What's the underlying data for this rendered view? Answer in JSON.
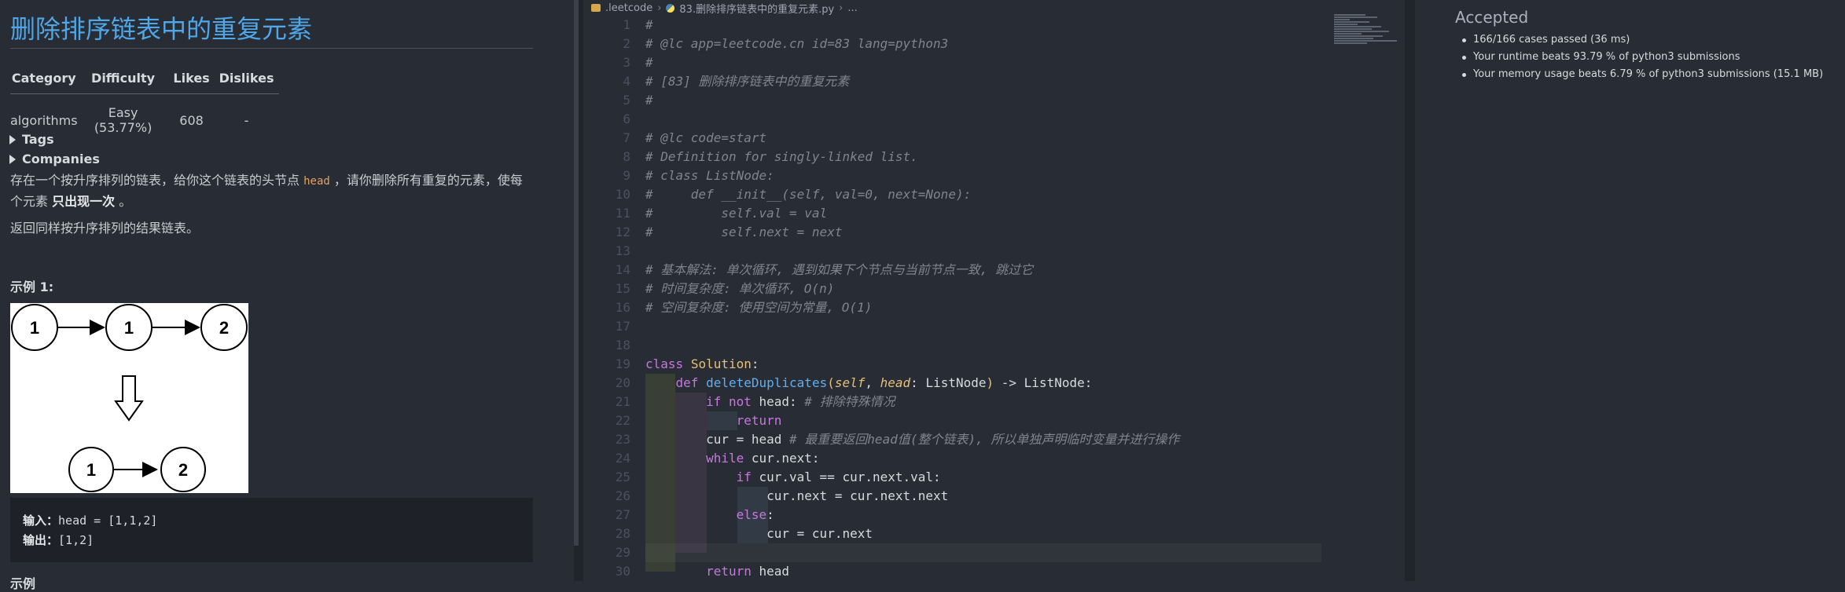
{
  "problem": {
    "title": "删除排序链表中的重复元素",
    "table": {
      "headers": [
        "Category",
        "Difficulty",
        "Likes",
        "Dislikes"
      ],
      "values": [
        "algorithms",
        "Easy (53.77%)",
        "608",
        "-"
      ]
    },
    "tags_label": "Tags",
    "companies_label": "Companies",
    "desc_part1": "存在一个按升序排列的链表，给你这个链表的头节点 ",
    "desc_code": "head",
    "desc_part2": " ，请你删除所有重复的元素，使每",
    "desc_part3": "个元素 ",
    "desc_bold": "只出现一次",
    "desc_part4": " 。",
    "desc_line2": "返回同样按升序排列的结果链表。",
    "example_label": "示例 1:",
    "diagram": {
      "top_nodes": [
        "1",
        "1",
        "2"
      ],
      "bottom_nodes": [
        "1",
        "2"
      ]
    },
    "input_label": "输入：",
    "input_value": "head = [1,1,2]",
    "output_label": "输出：",
    "output_value": "[1,2]",
    "next_label": "示例"
  },
  "editor": {
    "breadcrumb": [
      ".leetcode",
      "83.删除排序链表中的重复元素.py",
      "..."
    ],
    "line_numbers": [
      "1",
      "2",
      "3",
      "4",
      "5",
      "6",
      "7",
      "8",
      "9",
      "10",
      "11",
      "12",
      "13",
      "14",
      "15",
      "16",
      "17",
      "18",
      "19",
      "20",
      "21",
      "22",
      "23",
      "24",
      "25",
      "26",
      "27",
      "28",
      "29",
      "30"
    ],
    "code": {
      "l1": "#",
      "l2": "# @lc app=leetcode.cn id=83 lang=python3",
      "l3": "#",
      "l4": "# [83] 删除排序链表中的重复元素",
      "l5": "#",
      "l7": "# @lc code=start",
      "l8": "# Definition for singly-linked list.",
      "l9": "# class ListNode:",
      "l10": "#     def __init__(self, val=0, next=None):",
      "l11": "#         self.val = val",
      "l12": "#         self.next = next",
      "l14": "# 基本解法: 单次循环, 遇到如果下个节点与当前节点一致, 跳过它",
      "l15": "# 时间复杂度: 单次循环, O(n)",
      "l16": "# 空间复杂度: 使用空间为常量, O(1)",
      "l19_kw": "class",
      "l19_name": "Solution",
      "l19_end": ":",
      "l20_kw": "def",
      "l20_fn": "deleteDuplicates",
      "l20_self": "self",
      "l20_param": "head",
      "l20_type": "ListNode",
      "l20_ret": "ListNode",
      "l21_kw": "if not",
      "l21_rest": " head: ",
      "l21_cm": "# 排除特殊情况",
      "l22_kw": "return",
      "l23_code": "cur = head ",
      "l23_cm": "# 最重要返回head值(整个链表), 所以单独声明临时变量并进行操作",
      "l24_kw": "while",
      "l24_rest": " cur.next:",
      "l25_kw": "if",
      "l25_rest": " cur.val == cur.next.val:",
      "l26_code": "cur.next = cur.next.next",
      "l27_kw": "else",
      "l27_end": ":",
      "l28_code": "cur = cur.next",
      "l30_kw": "return",
      "l30_rest": " head"
    }
  },
  "result": {
    "status": "Accepted",
    "items": [
      "166/166 cases passed (36 ms)",
      "Your runtime beats 93.79 % of python3 submissions",
      "Your memory usage beats 6.79 % of python3 submissions (15.1 MB)"
    ]
  },
  "colors": {
    "accent_title": "#4fa7e8",
    "keyword": "#c678dd",
    "function": "#61afef",
    "class": "#e5c07b",
    "comment": "#7f848e"
  }
}
